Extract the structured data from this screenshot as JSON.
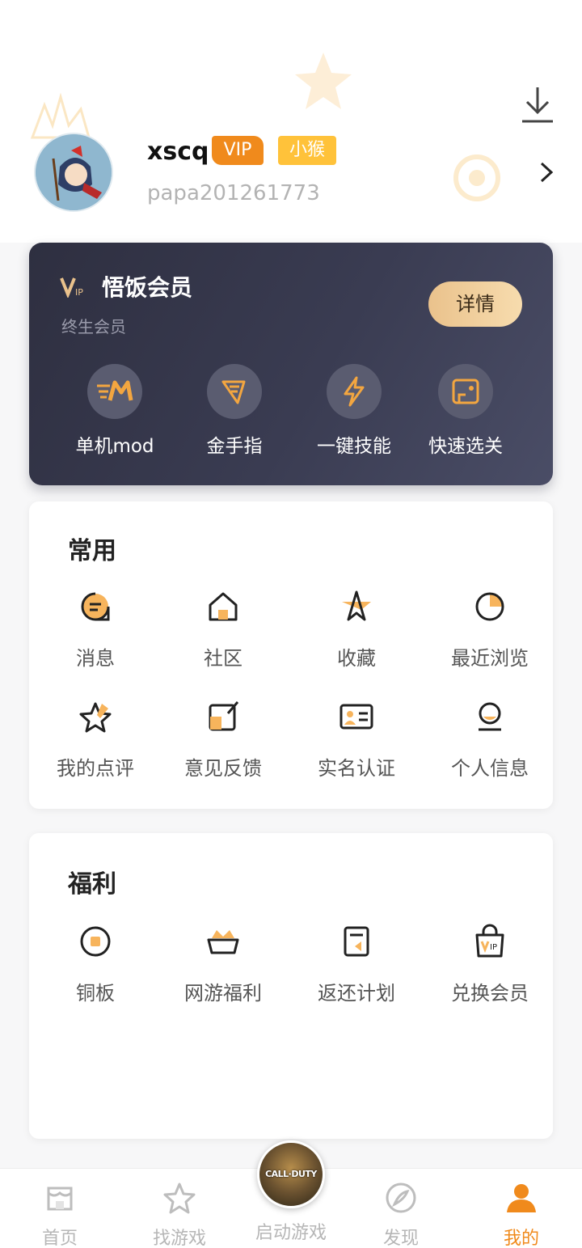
{
  "header": {
    "download_icon": "download-icon",
    "username": "xscq",
    "vip_badge": "VIP",
    "level_badge": "小猴",
    "user_id": "papa201261773"
  },
  "vip_card": {
    "logo": "VIP",
    "title": "悟饭会员",
    "subtitle": "终生会员",
    "detail_button": "详情",
    "perks": [
      {
        "label": "单机mod",
        "icon": "mod-icon"
      },
      {
        "label": "金手指",
        "icon": "golden-finger-icon"
      },
      {
        "label": "一键技能",
        "icon": "lightning-icon"
      },
      {
        "label": "快速选关",
        "icon": "level-select-icon"
      }
    ]
  },
  "common": {
    "title": "常用",
    "items": [
      {
        "label": "消息",
        "icon": "message-icon"
      },
      {
        "label": "社区",
        "icon": "community-icon"
      },
      {
        "label": "收藏",
        "icon": "favorite-icon"
      },
      {
        "label": "最近浏览",
        "icon": "recent-icon"
      },
      {
        "label": "我的点评",
        "icon": "review-icon"
      },
      {
        "label": "意见反馈",
        "icon": "feedback-icon"
      },
      {
        "label": "实名认证",
        "icon": "id-card-icon"
      },
      {
        "label": "个人信息",
        "icon": "profile-icon"
      }
    ]
  },
  "welfare": {
    "title": "福利",
    "items": [
      {
        "label": "铜板",
        "icon": "coin-icon"
      },
      {
        "label": "网游福利",
        "icon": "online-game-gift-icon"
      },
      {
        "label": "返还计划",
        "icon": "rebate-icon"
      },
      {
        "label": "兑换会员",
        "icon": "vip-bag-icon"
      }
    ]
  },
  "tabbar": {
    "tabs": [
      {
        "label": "首页",
        "icon": "home-icon"
      },
      {
        "label": "找游戏",
        "icon": "star-icon"
      },
      {
        "label": "启动游戏",
        "icon": "game-launch-icon"
      },
      {
        "label": "发现",
        "icon": "compass-icon"
      },
      {
        "label": "我的",
        "icon": "user-icon"
      }
    ],
    "active_index": 4,
    "center_game_text": "CALL·DUTY"
  },
  "colors": {
    "accent": "#f08a1c",
    "vip_gold": "#eac28c",
    "vip_card_bg": "#35374a",
    "level_badge": "#ffc23a"
  }
}
